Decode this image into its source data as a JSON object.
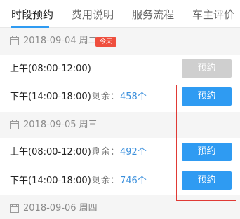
{
  "tabs": [
    {
      "label": "时段预约",
      "active": true
    },
    {
      "label": "费用说明",
      "active": false
    },
    {
      "label": "服务流程",
      "active": false
    },
    {
      "label": "车主评价",
      "active": false
    }
  ],
  "days": [
    {
      "date": "2018-09-04 周二",
      "badge": "今天",
      "slots": [
        {
          "time": "上午(08:00-12:00)",
          "remain_label": "",
          "remain": "",
          "button": "预约",
          "enabled": false
        },
        {
          "time": "下午(14:00-18:00)",
          "remain_label": "剩余：",
          "remain": "458个",
          "button": "预约",
          "enabled": true
        }
      ]
    },
    {
      "date": "2018-09-05 周三",
      "slots": [
        {
          "time": "上午(08:00-12:00)",
          "remain_label": "剩余：",
          "remain": "492个",
          "button": "预约",
          "enabled": true
        },
        {
          "time": "下午(14:00-18:00)",
          "remain_label": "剩余：",
          "remain": "746个",
          "button": "预约",
          "enabled": true
        }
      ]
    },
    {
      "date": "2018-09-06 周四",
      "slots": []
    }
  ],
  "colors": {
    "accent": "#2f9bf2",
    "today_badge": "#ef4f3e",
    "disabled_button": "#cfcfcf",
    "highlight_border": "#e03a35"
  }
}
